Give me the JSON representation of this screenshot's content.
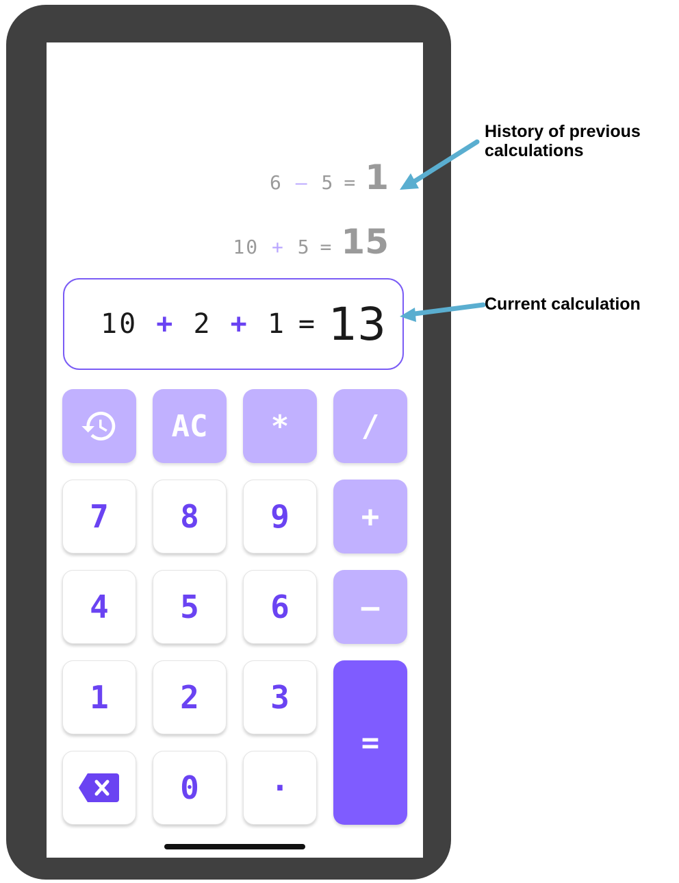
{
  "history": [
    {
      "left": "6",
      "op": "–",
      "right": "5",
      "eq": "=",
      "result": "1"
    },
    {
      "left": "10",
      "op": "+",
      "right": "5",
      "eq": "=",
      "result": "15"
    }
  ],
  "current": {
    "a": "10",
    "op1": "+",
    "b": "2",
    "op2": "+",
    "c": "1",
    "eq": "=",
    "result": "13"
  },
  "keys": {
    "history_icon": "history-icon",
    "ac": "AC",
    "multiply": "*",
    "divide": "/",
    "seven": "7",
    "eight": "8",
    "nine": "9",
    "plus": "+",
    "four": "4",
    "five": "5",
    "six": "6",
    "minus": "–",
    "one": "1",
    "two": "2",
    "three": "3",
    "equals": "=",
    "backspace_icon": "backspace-icon",
    "zero": "0",
    "dot": "·"
  },
  "annotations": {
    "history_label": "History of previous calculations",
    "current_label": "Current calculation"
  },
  "colors": {
    "accent": "#6a43f2",
    "function_key": "#c1b1ff",
    "equals_key": "#7f5cff",
    "frame": "#404040",
    "arrow": "#5aaed0"
  }
}
